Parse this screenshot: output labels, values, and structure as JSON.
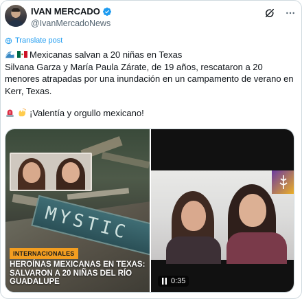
{
  "author": {
    "display_name": "IVAN MERCADO",
    "handle": "@IvanMercadoNews",
    "verified_color": "#1d9bf0"
  },
  "header_icons": [
    "grok-icon",
    "more-icon"
  ],
  "translate_label": "Translate post",
  "post": {
    "line1": "Mexicanas salvan a 20 niñas en Texas",
    "line2": "Silvana Garza y María Paula Zárate, de 19 años, rescataron a 20 menores atrapadas por una inundación en un campamento de verano en Kerr, Texas.",
    "line3": "¡Valentía y orgullo mexicano!"
  },
  "media": {
    "left": {
      "tag": "INTERNACIONALES",
      "headline": "HEROÍNAS MEXICANAS EN TEXAS: SALVARON A 20 NIÑAS DEL RÍO GUADALUPE",
      "sign_text": "MYSTIC",
      "tag_color": "#f29d20"
    },
    "right": {
      "duration": "0:35",
      "icon": "pause-icon"
    }
  }
}
